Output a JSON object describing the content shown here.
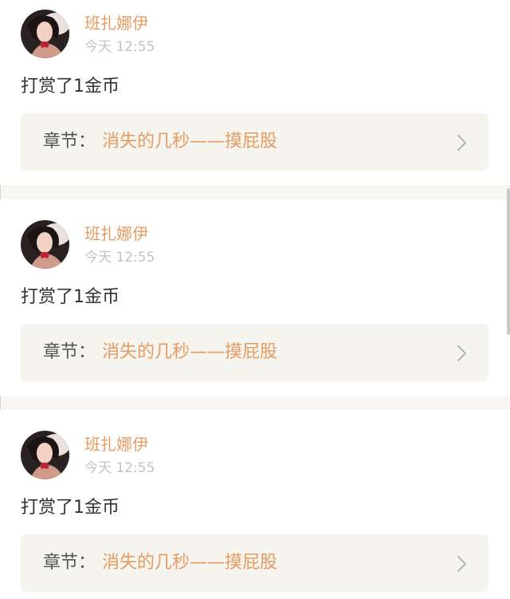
{
  "colors": {
    "accent": "#e59b62",
    "text": "#333333",
    "muted": "#c3c3c3",
    "card_bg": "#ffffff",
    "chapter_bg": "#f5f4ee",
    "feed_bg": "#f7f6f3"
  },
  "feed": {
    "items": [
      {
        "avatar_icon": "user-avatar-icon",
        "username": "班扎娜伊",
        "time": "今天 12:55",
        "message": "打赏了1金币",
        "chapter_label": "章节：",
        "chapter_title": "消失的几秒——摸屁股",
        "chevron_icon": "chevron-right-icon"
      },
      {
        "avatar_icon": "user-avatar-icon",
        "username": "班扎娜伊",
        "time": "今天 12:55",
        "message": "打赏了1金币",
        "chapter_label": "章节：",
        "chapter_title": "消失的几秒——摸屁股",
        "chevron_icon": "chevron-right-icon"
      },
      {
        "avatar_icon": "user-avatar-icon",
        "username": "班扎娜伊",
        "time": "今天 12:55",
        "message": "打赏了1金币",
        "chapter_label": "章节：",
        "chapter_title": "消失的几秒——摸屁股",
        "chevron_icon": "chevron-right-icon"
      }
    ]
  }
}
